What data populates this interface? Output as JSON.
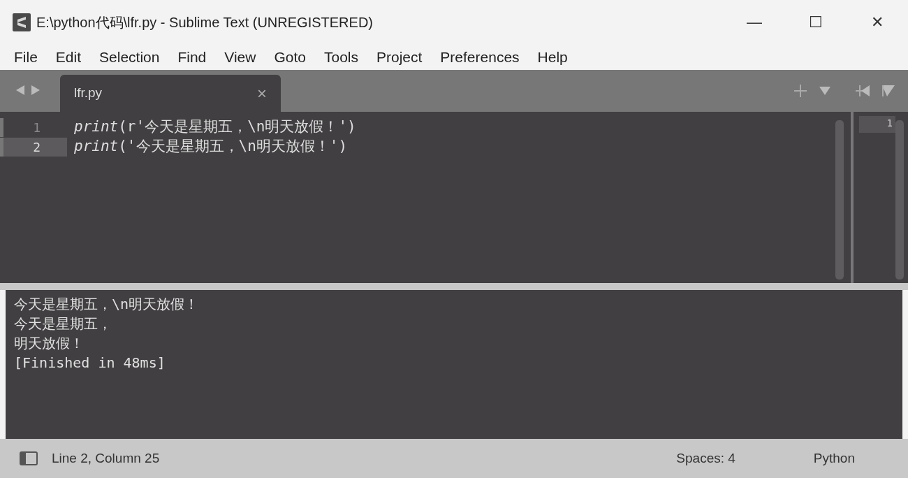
{
  "window": {
    "title": "E:\\python代码\\lfr.py - Sublime Text (UNREGISTERED)",
    "controls": [
      "—",
      "☐",
      "✕"
    ]
  },
  "menu": [
    "File",
    "Edit",
    "Selection",
    "Find",
    "View",
    "Goto",
    "Tools",
    "Project",
    "Preferences",
    "Help"
  ],
  "tabs": [
    {
      "label": "lfr.py",
      "selected": true,
      "close": "×"
    }
  ],
  "editor": {
    "lines": [
      {
        "number": "1",
        "text": "*print*(r'今天是星期五，\\n明天放假！')",
        "selected": false
      },
      {
        "number": "2",
        "text": "*print*('今天是星期五，\\n明天放假！')",
        "selected": true
      }
    ]
  },
  "side_pane": {
    "line_number": "1"
  },
  "output": {
    "lines": [
      "今天是星期五，\\n明天放假！",
      "今天是星期五，",
      "明天放假！",
      "[Finished in 48ms]"
    ]
  },
  "status_bar": {
    "position": "Line 2, Column 25",
    "indent": "Spaces: 4",
    "syntax": "Python"
  }
}
